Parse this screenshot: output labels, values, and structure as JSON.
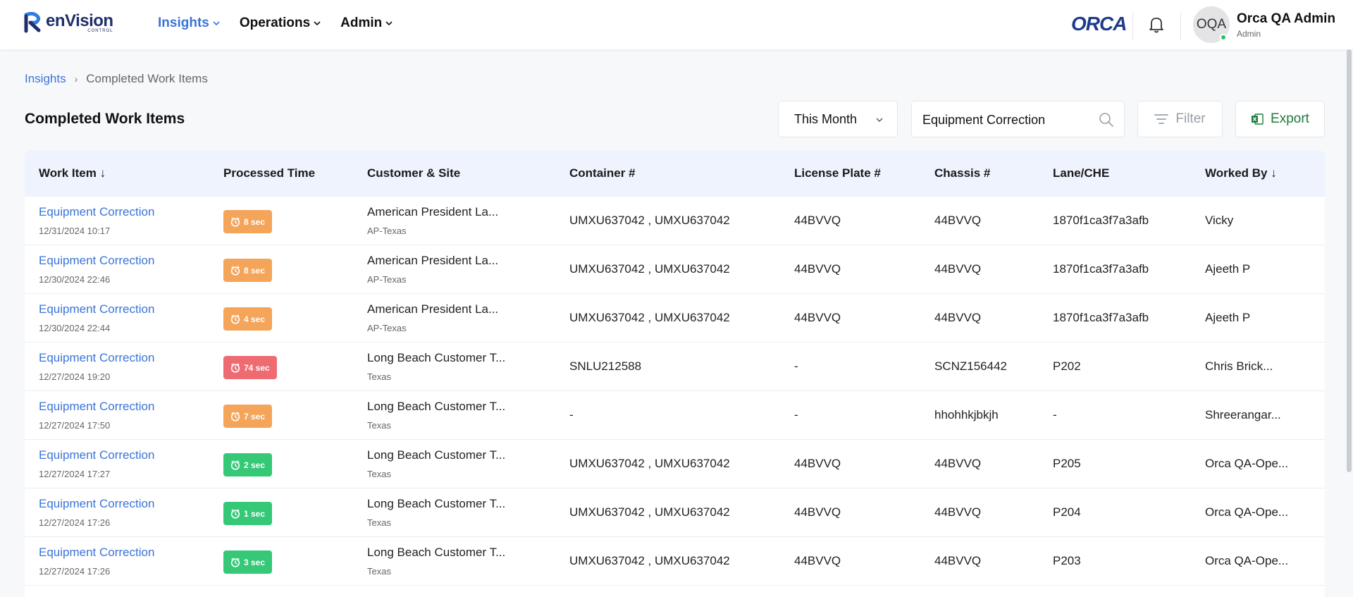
{
  "header": {
    "logo_text": "enVision",
    "logo_sub": "CONTROL",
    "nav": [
      {
        "label": "Insights"
      },
      {
        "label": "Operations"
      },
      {
        "label": "Admin"
      }
    ],
    "partner_logo": "ORCA",
    "user": {
      "initials": "OQA",
      "name": "Orca QA Admin",
      "role": "Admin"
    }
  },
  "breadcrumb": {
    "root": "Insights",
    "current": "Completed Work Items"
  },
  "page": {
    "title": "Completed Work Items"
  },
  "toolbar": {
    "period": "This Month",
    "search_value": "Equipment Correction",
    "filter_label": "Filter",
    "export_label": "Export"
  },
  "colors": {
    "accent": "#3a74d8",
    "badge_orange": "#f4a55a",
    "badge_red": "#ef6b72",
    "badge_green": "#35c977",
    "export_green": "#1f7a3d"
  },
  "table": {
    "columns": [
      "Work Item ↓",
      "Processed Time",
      "Customer & Site",
      "Container #",
      "License Plate #",
      "Chassis #",
      "Lane/CHE",
      "Worked By ↓"
    ],
    "rows": [
      {
        "title": "Equipment Correction",
        "date": "12/31/2024 10:17",
        "time": "8 sec",
        "status": "orange",
        "customer": "American President La...",
        "site": "AP-Texas",
        "container": "UMXU637042 , UMXU637042",
        "plate": "44BVVQ",
        "chassis": "44BVVQ",
        "lane": "1870f1ca3f7a3afb",
        "worked_by": "Vicky"
      },
      {
        "title": "Equipment Correction",
        "date": "12/30/2024 22:46",
        "time": "8 sec",
        "status": "orange",
        "customer": "American President La...",
        "site": "AP-Texas",
        "container": "UMXU637042 , UMXU637042",
        "plate": "44BVVQ",
        "chassis": "44BVVQ",
        "lane": "1870f1ca3f7a3afb",
        "worked_by": "Ajeeth P"
      },
      {
        "title": "Equipment Correction",
        "date": "12/30/2024 22:44",
        "time": "4 sec",
        "status": "orange",
        "customer": "American President La...",
        "site": "AP-Texas",
        "container": "UMXU637042 , UMXU637042",
        "plate": "44BVVQ",
        "chassis": "44BVVQ",
        "lane": "1870f1ca3f7a3afb",
        "worked_by": "Ajeeth P"
      },
      {
        "title": "Equipment Correction",
        "date": "12/27/2024 19:20",
        "time": "74 sec",
        "status": "red",
        "customer": "Long Beach Customer T...",
        "site": "Texas",
        "container": "SNLU212588",
        "plate": "-",
        "chassis": "SCNZ156442",
        "lane": "P202",
        "worked_by": "Chris Brick..."
      },
      {
        "title": "Equipment Correction",
        "date": "12/27/2024 17:50",
        "time": "7 sec",
        "status": "orange",
        "customer": "Long Beach Customer T...",
        "site": "Texas",
        "container": "-",
        "plate": "-",
        "chassis": "hhohhkjbkjh",
        "lane": "-",
        "worked_by": "Shreerangar..."
      },
      {
        "title": "Equipment Correction",
        "date": "12/27/2024 17:27",
        "time": "2 sec",
        "status": "green",
        "customer": "Long Beach Customer T...",
        "site": "Texas",
        "container": "UMXU637042 , UMXU637042",
        "plate": "44BVVQ",
        "chassis": "44BVVQ",
        "lane": "P205",
        "worked_by": "Orca QA-Ope..."
      },
      {
        "title": "Equipment Correction",
        "date": "12/27/2024 17:26",
        "time": "1 sec",
        "status": "green",
        "customer": "Long Beach Customer T...",
        "site": "Texas",
        "container": "UMXU637042 , UMXU637042",
        "plate": "44BVVQ",
        "chassis": "44BVVQ",
        "lane": "P204",
        "worked_by": "Orca QA-Ope..."
      },
      {
        "title": "Equipment Correction",
        "date": "12/27/2024 17:26",
        "time": "3 sec",
        "status": "green",
        "customer": "Long Beach Customer T...",
        "site": "Texas",
        "container": "UMXU637042 , UMXU637042",
        "plate": "44BVVQ",
        "chassis": "44BVVQ",
        "lane": "P203",
        "worked_by": "Orca QA-Ope..."
      }
    ]
  },
  "icons": [
    "envision-logo-icon",
    "chevron-down-icon",
    "bell-icon",
    "search-icon",
    "filter-icon",
    "excel-icon",
    "clock-icon"
  ]
}
